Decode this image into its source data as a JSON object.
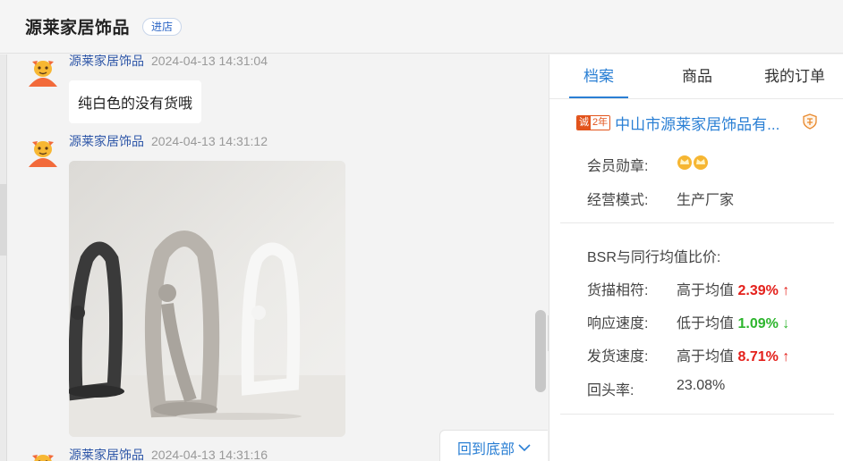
{
  "header": {
    "shop_name": "源莱家居饰品",
    "enter_store_label": "进店"
  },
  "messages": [
    {
      "sender": "源莱家居饰品",
      "time": "2024-04-13 14:31:04",
      "text": "纯白色的没有货哦"
    },
    {
      "sender": "源莱家居饰品",
      "time": "2024-04-13 14:31:12",
      "image": "abstract-sculpture-photo"
    },
    {
      "sender": "源莱家居饰品",
      "time": "2024-04-13 14:31:16"
    }
  ],
  "back_to_bottom_label": "回到底部",
  "collapse_icon": "double-chevron-right-icon",
  "panel": {
    "tabs": [
      {
        "label": "档案",
        "active": true
      },
      {
        "label": "商品",
        "active": false
      },
      {
        "label": "我的订单",
        "active": false
      }
    ],
    "badge_cheng": "诚",
    "badge_years": "2年",
    "company_name": "中山市源莱家居饰品有...",
    "member_badge_label": "会员勋章:",
    "business_mode_label": "经营模式:",
    "business_mode_value": "生产厂家",
    "bsr_title": "BSR与同行均值比价:",
    "metrics": [
      {
        "label": "货描相符:",
        "compare": "高于均值",
        "value": "2.39%",
        "arrow": "↑",
        "direction": "up"
      },
      {
        "label": "响应速度:",
        "compare": "低于均值",
        "value": "1.09%",
        "arrow": "↓",
        "direction": "down"
      },
      {
        "label": "发货速度:",
        "compare": "高于均值",
        "value": "8.71%",
        "arrow": "↑",
        "direction": "up"
      }
    ],
    "repeat_rate_label": "回头率:",
    "repeat_rate_value": "23.08%"
  },
  "colors": {
    "accent_blue": "#2a7fd4",
    "up_red": "#e4201b",
    "down_green": "#2db52d",
    "cheng_orange": "#e2531b"
  }
}
